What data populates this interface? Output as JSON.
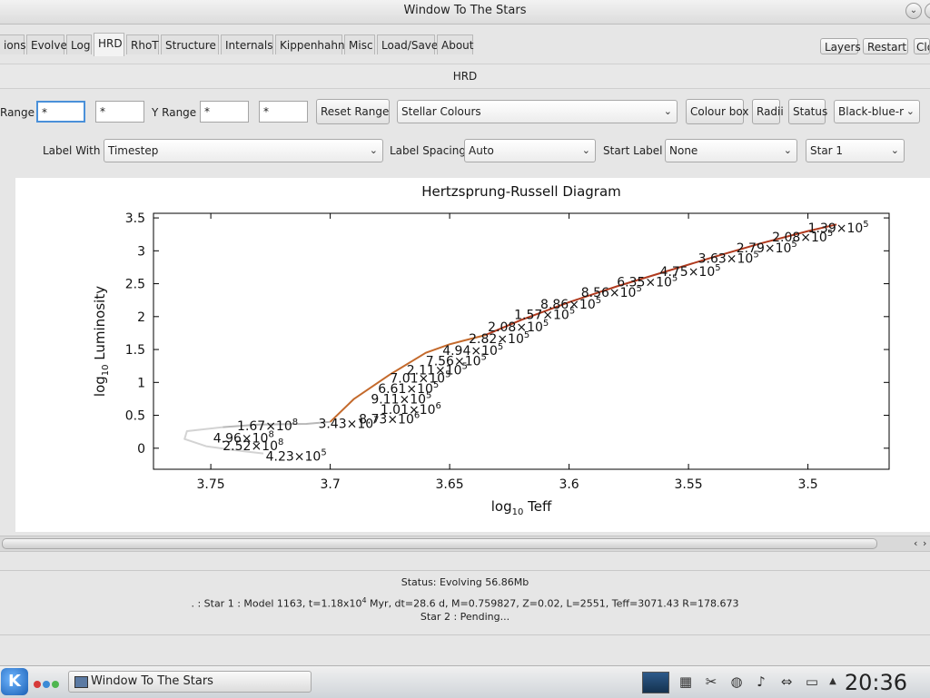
{
  "window": {
    "title": "Window To The Stars"
  },
  "tabs": [
    {
      "label": "ions"
    },
    {
      "label": "Evolve"
    },
    {
      "label": "Log"
    },
    {
      "label": "HRD"
    },
    {
      "label": "RhoT"
    },
    {
      "label": "Structure"
    },
    {
      "label": "Internals"
    },
    {
      "label": "Kippenhahn"
    },
    {
      "label": "Misc"
    },
    {
      "label": "Load/Save"
    },
    {
      "label": "About"
    }
  ],
  "tab_actions": {
    "layers": "Layers",
    "restart": "Restart",
    "close": "Clo"
  },
  "panel": {
    "title": "HRD"
  },
  "controls": {
    "x_range_label": "Range",
    "x_min": "*",
    "x_max": "*",
    "y_range_label": "Y Range",
    "y_min": "*",
    "y_max": "*",
    "reset_range": "Reset Range",
    "colour_scheme": "Stellar Colours",
    "colour_box": "Colour box",
    "radii": "Radii",
    "status": "Status",
    "palette": "Black-blue-r",
    "label_with_label": "Label With",
    "label_with": "Timestep",
    "label_spacing_label": "Label Spacing",
    "label_spacing": "Auto",
    "start_label_label": "Start Label",
    "start_label": "None",
    "star_select": "Star 1"
  },
  "chart_data": {
    "type": "line",
    "title": "Hertzsprung-Russell Diagram",
    "xlabel": "log10 Teff",
    "ylabel": "log10 Luminosity",
    "xlim": [
      3.774,
      3.466
    ],
    "ylim": [
      -0.32,
      3.57
    ],
    "x_reversed": true,
    "xticks": [
      "3.75",
      "3.7",
      "3.65",
      "3.6",
      "3.55",
      "3.5"
    ],
    "yticks": [
      "0",
      "0.5",
      "1",
      "1.5",
      "2",
      "2.5",
      "3",
      "3.5"
    ],
    "grid": false,
    "series": [
      {
        "color": "#d3d3d3",
        "x": [
          3.745,
          3.76,
          3.761,
          3.752,
          3.74,
          3.728
        ],
        "y": [
          0.32,
          0.26,
          0.14,
          0.03,
          -0.03,
          -0.08
        ]
      },
      {
        "color": "#b8b8b8",
        "x": [
          3.745,
          3.73,
          3.71,
          3.7
        ],
        "y": [
          0.32,
          0.36,
          0.37,
          0.4
        ]
      },
      {
        "color": "#c46a2c",
        "x": [
          3.7,
          3.69,
          3.675,
          3.66,
          3.65,
          3.635
        ],
        "y": [
          0.4,
          0.75,
          1.12,
          1.45,
          1.58,
          1.72
        ]
      },
      {
        "color": "#b03a1e",
        "x": [
          3.635,
          3.62,
          3.6,
          3.58,
          3.56,
          3.54,
          3.52,
          3.5,
          3.488
        ],
        "y": [
          1.72,
          1.95,
          2.22,
          2.46,
          2.68,
          2.9,
          3.11,
          3.3,
          3.4
        ]
      }
    ],
    "annotations": [
      {
        "x": 3.739,
        "y": 0.27,
        "text": "1.67×10",
        "sup": "8"
      },
      {
        "x": 3.705,
        "y": 0.31,
        "text": "3.43×10",
        "sup": "7"
      },
      {
        "x": 3.749,
        "y": 0.09,
        "text": "4.96×10",
        "sup": "8"
      },
      {
        "x": 3.745,
        "y": -0.03,
        "text": "2.52×10",
        "sup": "8"
      },
      {
        "x": 3.727,
        "y": -0.19,
        "text": "4.23×10",
        "sup": "5"
      },
      {
        "x": 3.688,
        "y": 0.38,
        "text": "8.73×10",
        "sup": "6"
      },
      {
        "x": 3.679,
        "y": 0.52,
        "text": "1.01×10",
        "sup": "6"
      },
      {
        "x": 3.683,
        "y": 0.68,
        "text": "9.11×10",
        "sup": "5"
      },
      {
        "x": 3.68,
        "y": 0.84,
        "text": "6.61×10",
        "sup": "5"
      },
      {
        "x": 3.675,
        "y": 1.0,
        "text": "7.01×10",
        "sup": "5"
      },
      {
        "x": 3.668,
        "y": 1.12,
        "text": "2.11×10",
        "sup": "5"
      },
      {
        "x": 3.66,
        "y": 1.26,
        "text": "7.56×10",
        "sup": "5"
      },
      {
        "x": 3.653,
        "y": 1.42,
        "text": "4.94×10",
        "sup": "5"
      },
      {
        "x": 3.642,
        "y": 1.6,
        "text": "2.82×10",
        "sup": "5"
      },
      {
        "x": 3.634,
        "y": 1.78,
        "text": "2.08×10",
        "sup": "5"
      },
      {
        "x": 3.623,
        "y": 1.96,
        "text": "1.57×10",
        "sup": "5"
      },
      {
        "x": 3.612,
        "y": 2.12,
        "text": "8.86×10",
        "sup": "5"
      },
      {
        "x": 3.595,
        "y": 2.3,
        "text": "8.56×10",
        "sup": "5"
      },
      {
        "x": 3.58,
        "y": 2.46,
        "text": "6.35×10",
        "sup": "5"
      },
      {
        "x": 3.562,
        "y": 2.62,
        "text": "4.75×10",
        "sup": "5"
      },
      {
        "x": 3.546,
        "y": 2.82,
        "text": "3.63×10",
        "sup": "5"
      },
      {
        "x": 3.53,
        "y": 2.98,
        "text": "2.79×10",
        "sup": "5"
      },
      {
        "x": 3.515,
        "y": 3.14,
        "text": "2.08×10",
        "sup": "5"
      },
      {
        "x": 3.5,
        "y": 3.28,
        "text": "1.39×10",
        "sup": "5"
      }
    ]
  },
  "status": {
    "line1": "Status: Evolving  56.86Mb",
    "line2_prefix": ". : Star 1 : Model 1163, t=1.18x10",
    "line2_sup": "4",
    "line2_suffix": " Myr, dt=28.6 d, M=0.759827, Z=0.02, L=2551, Teff=3071.43 R=178.673",
    "line3": "Star 2 : Pending..."
  },
  "taskbar": {
    "task_title": "Window To The Stars",
    "clock": "20:36",
    "kicon": "K"
  },
  "icons": {
    "start": "kde-menu-icon",
    "tray": [
      "monitor-icon",
      "network-icon",
      "scissors-icon",
      "globe-icon",
      "volume-icon",
      "connection-icon",
      "display-icon",
      "expand-tray-icon"
    ]
  }
}
